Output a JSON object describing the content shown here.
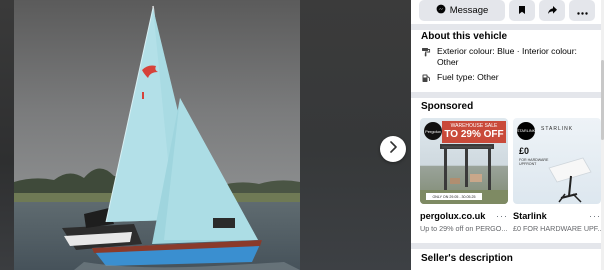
{
  "viewer": {
    "next_button": "chevron-right-icon"
  },
  "actions": {
    "message_label": "Message",
    "save_icon": "bookmark-icon",
    "share_icon": "share-icon",
    "more_icon": "more-icon"
  },
  "about": {
    "title": "About this vehicle",
    "details": [
      {
        "icon": "paint-icon",
        "text": "Exterior colour: Blue · Interior colour: Other"
      },
      {
        "icon": "fuel-icon",
        "text": "Fuel type: Other"
      }
    ]
  },
  "sponsored": {
    "title": "Sponsored",
    "ads": [
      {
        "name": "pergolux.co.uk",
        "more": "···",
        "desc": "Up to 29% off on PERGO...",
        "image": {
          "logo": "Pergolux",
          "banner_top": "WAREHOUSE SALE",
          "banner_main": "TO 29% OFF",
          "strip": "ONLY ON 29.05 - 30.05.25"
        }
      },
      {
        "name": "Starlink",
        "more": "···",
        "desc": "£0 FOR HARDWARE UPF...",
        "image": {
          "logo": "STARLINK",
          "brand": "STARLINK",
          "price": "£0",
          "sub": "FOR HARDWARE UPFRONT"
        }
      }
    ]
  },
  "seller": {
    "title": "Seller's description"
  },
  "colors": {
    "panel_bg": "#ffffff",
    "button_bg": "#e4e6eb",
    "separator": "#e4e6eb",
    "text_primary": "#050505",
    "text_secondary": "#65676b",
    "sail": "#a9dbe3",
    "hull": "#3a8fd0"
  }
}
